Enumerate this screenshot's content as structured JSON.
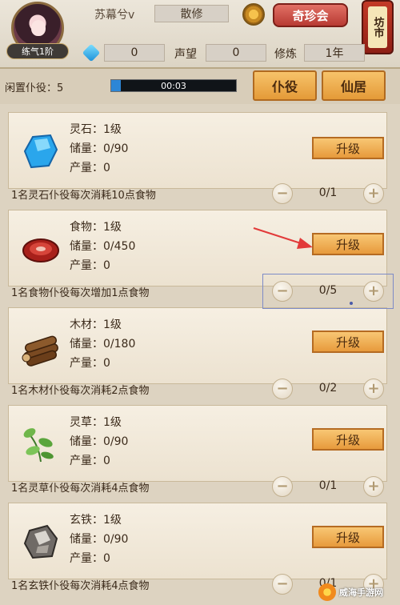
{
  "header": {
    "player_name": "苏幕兮v",
    "sect": "散修",
    "treasure_button": "奇珍会",
    "market_label": "坊市",
    "rank_badge": "练气1阶",
    "spirit_stones": "0",
    "reputation_label": "声望",
    "reputation_value": "0",
    "cultivation_label": "修炼",
    "cultivation_value": "1年"
  },
  "controls": {
    "idle_label": "闲置仆役：5",
    "timer": "00:03",
    "timer_progress": 0.08,
    "servant_button": "仆役",
    "residence_button": "仙居"
  },
  "resources": [
    {
      "name": "灵石：1级",
      "storage": "储量：0/90",
      "output": "产量：0",
      "upgrade": "升级",
      "info": "1名灵石仆役每次消耗10点食物",
      "count": "0/1",
      "icon": "spirit-stone-icon"
    },
    {
      "name": "食物：1级",
      "storage": "储量：0/450",
      "output": "产量：0",
      "upgrade": "升级",
      "info": "1名食物仆役每次增加1点食物",
      "count": "0/5",
      "icon": "meat-icon"
    },
    {
      "name": "木材：1级",
      "storage": "储量：0/180",
      "output": "产量：0",
      "upgrade": "升级",
      "info": "1名木材仆役每次消耗2点食物",
      "count": "0/2",
      "icon": "wood-logs-icon"
    },
    {
      "name": "灵草：1级",
      "storage": "储量：0/90",
      "output": "产量：0",
      "upgrade": "升级",
      "info": "1名灵草仆役每次消耗4点食物",
      "count": "0/1",
      "icon": "herb-icon"
    },
    {
      "name": "玄铁：1级",
      "storage": "储量：0/90",
      "output": "产量：0",
      "upgrade": "升级",
      "info": "1名玄铁仆役每次消耗4点食物",
      "count": "0/1",
      "icon": "iron-ore-icon"
    }
  ],
  "buttons": {
    "minus": "−",
    "plus": "+"
  },
  "watermark": "威海手游网",
  "colors": {
    "accent_orange": "#e79a3c",
    "treasure_red": "#b83b33",
    "progress_blue": "#2d86d6",
    "arrow_red": "#e23a3a"
  }
}
